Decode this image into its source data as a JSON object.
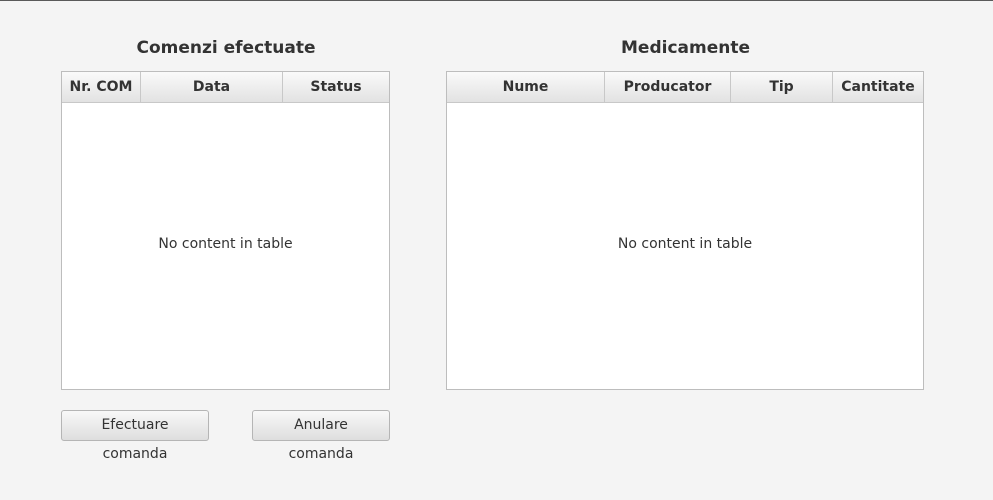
{
  "orders_panel": {
    "title": "Comenzi efectuate",
    "columns": [
      "Nr. COM",
      "Data",
      "Status"
    ],
    "placeholder": "No content in table"
  },
  "medicines_panel": {
    "title": "Medicamente",
    "columns": [
      "Nume",
      "Producator",
      "Tip",
      "Cantitate"
    ],
    "placeholder": "No content in table"
  },
  "actions": {
    "place_order_label": "Efectuare comanda",
    "cancel_order_label": "Anulare comanda"
  }
}
